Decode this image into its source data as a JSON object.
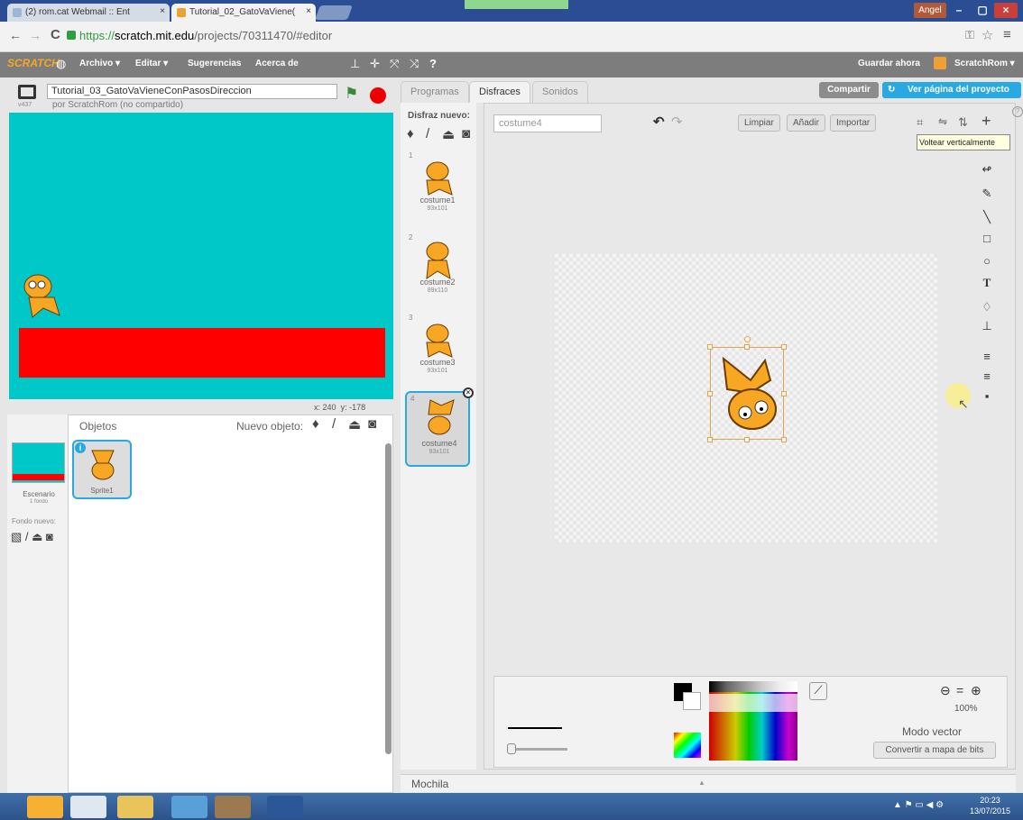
{
  "browser": {
    "tabs": [
      {
        "label": "(2) rom.cat Webmail :: Ent",
        "close": "×"
      },
      {
        "label": "Tutorial_02_GatoVaViene(",
        "close": "×"
      }
    ],
    "user": "Angel",
    "window_buttons": [
      "–",
      "▢",
      "×"
    ],
    "url_scheme": "https://",
    "url_host": "scratch.mit.edu",
    "url_path": "/projects/70311470/#editor"
  },
  "menubar": {
    "logo": "SCRATCH",
    "items": [
      "Archivo ▾",
      "Editar ▾",
      "Sugerencias",
      "Acerca de"
    ],
    "save": "Guardar ahora",
    "account": "ScratchRom ▾"
  },
  "stage": {
    "version": "v437",
    "title": "Tutorial_03_GatoVaVieneConPasosDireccion",
    "byline": "por ScratchRom (no compartido)",
    "x_label": "x:",
    "x_value": "240",
    "y_label": "y:",
    "y_value": "-178"
  },
  "sprites": {
    "header": "Objetos",
    "new_object": "Nuevo objeto:",
    "stage_label": "Escenario",
    "stage_sub": "1 fondo",
    "new_bg": "Fondo nuevo:",
    "sprite_name": "Sprite1"
  },
  "tabs": [
    "Programas",
    "Disfraces",
    "Sonidos"
  ],
  "top_buttons": {
    "share": "Compartir",
    "view": "Ver página del proyecto"
  },
  "costumes": {
    "new_label": "Disfraz nuevo:",
    "items": [
      {
        "num": "1",
        "name": "costume1",
        "size": "93x101"
      },
      {
        "num": "2",
        "name": "costume2",
        "size": "89x110"
      },
      {
        "num": "3",
        "name": "costume3",
        "size": "93x101"
      },
      {
        "num": "4",
        "name": "costume4",
        "size": "93x101"
      }
    ]
  },
  "editor": {
    "costume_name": "costume4",
    "btn_clear": "Limpiar",
    "btn_add": "Añadir",
    "btn_import": "Importar",
    "tooltip": "Voltear verticalmente",
    "zoom": "100%",
    "mode": "Modo vector",
    "convert": "Convertir a mapa de bits"
  },
  "mochila": "Mochila",
  "taskbar": {
    "time": "20:23",
    "date": "13/07/2015"
  }
}
